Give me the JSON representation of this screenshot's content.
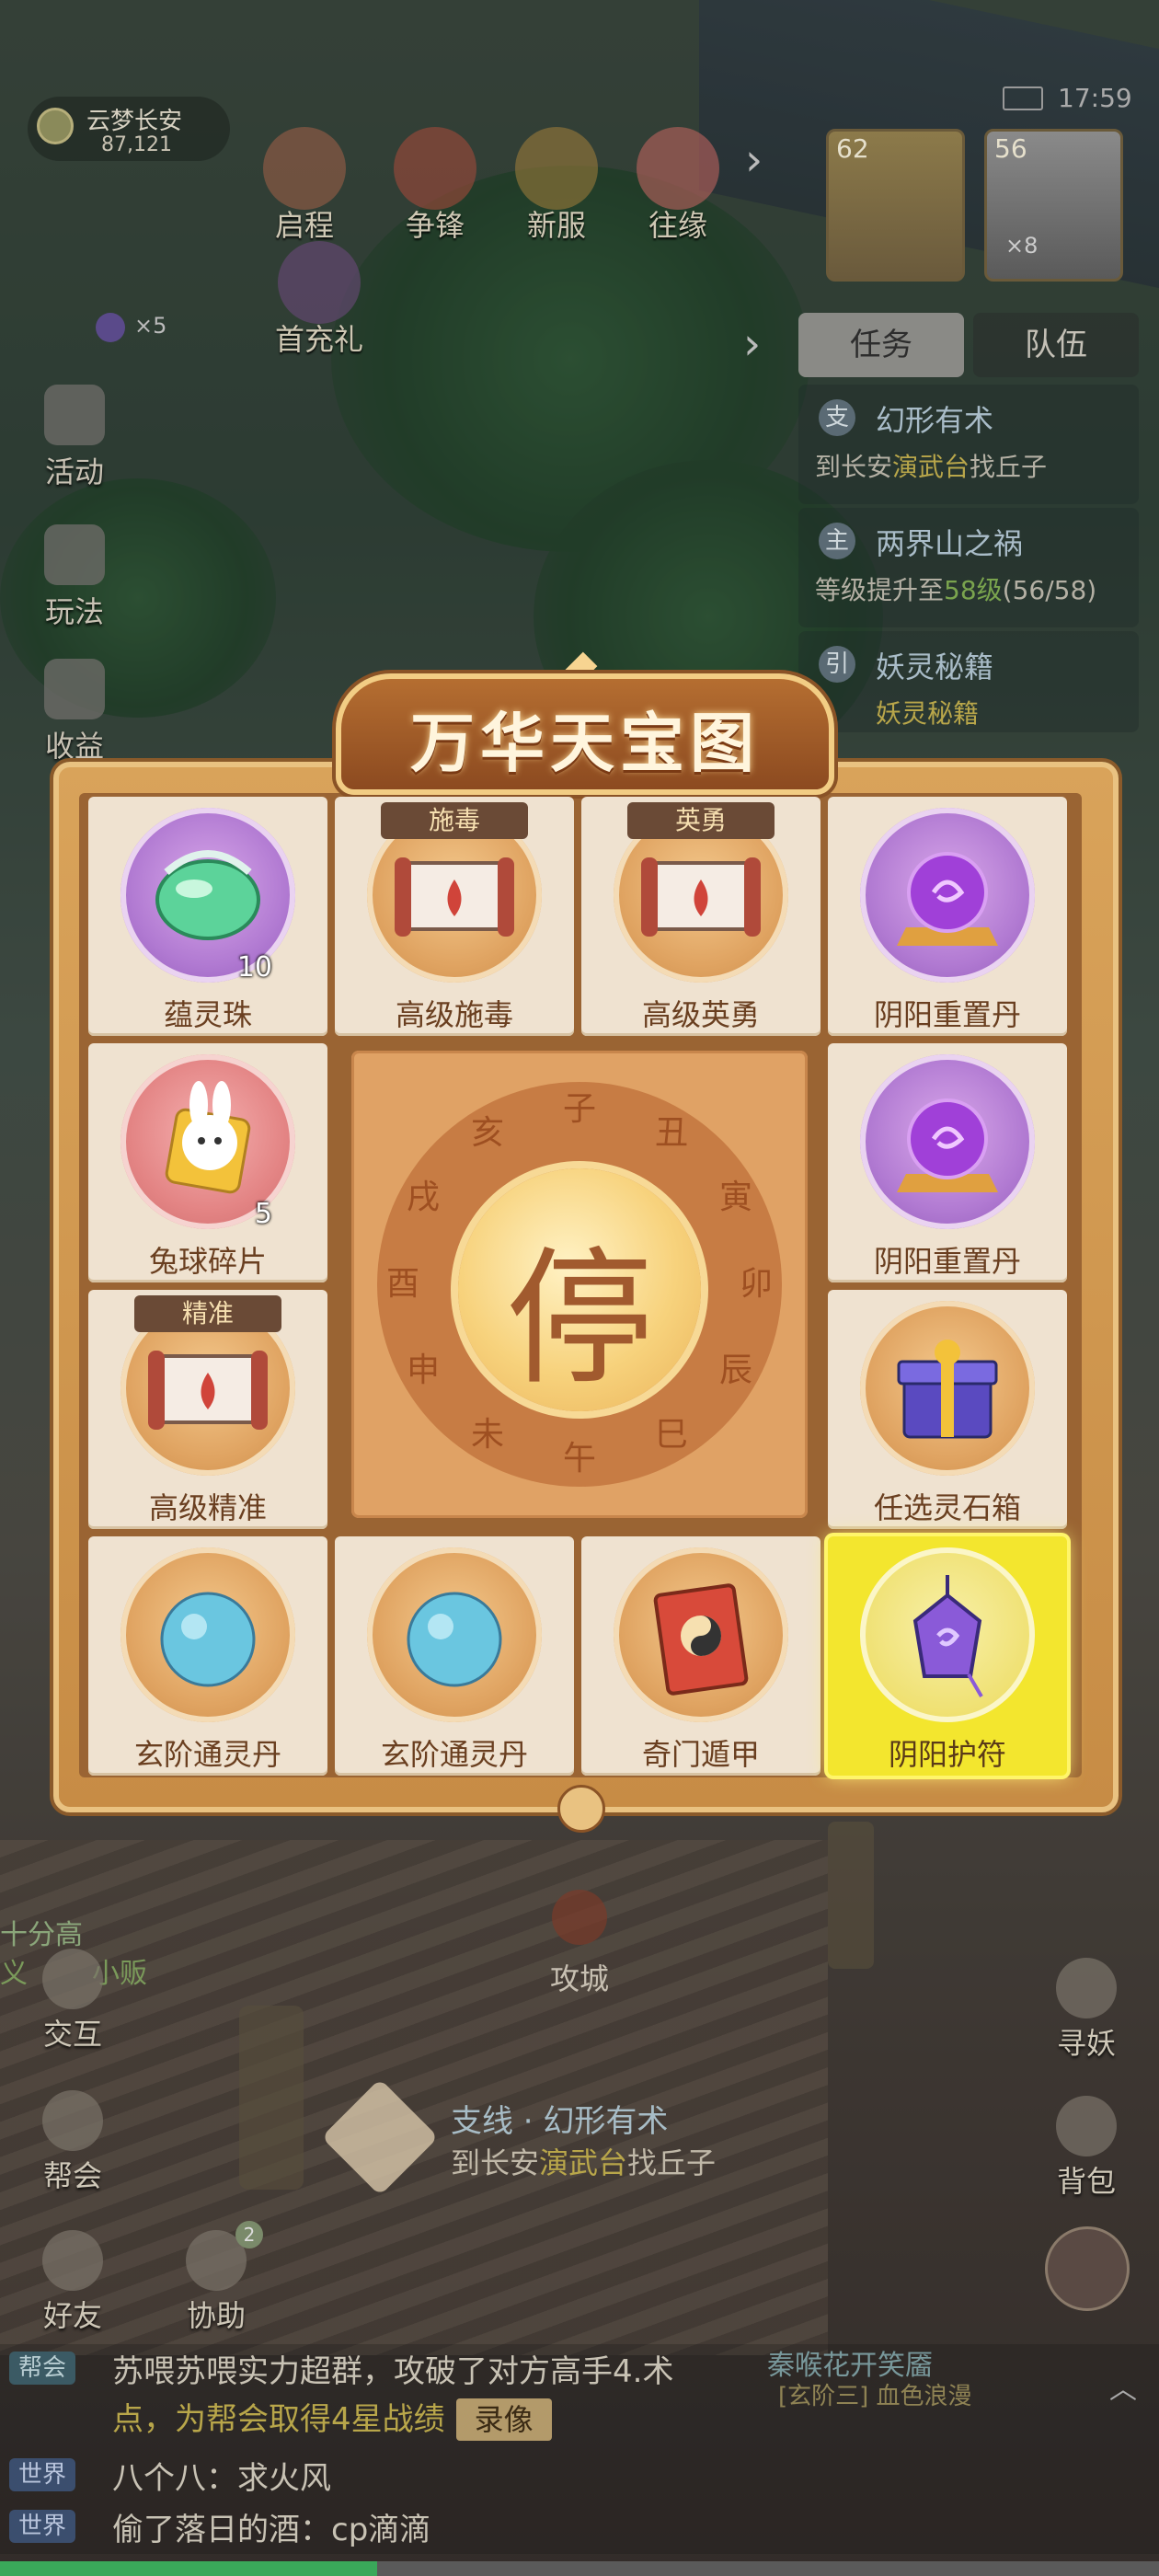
{
  "status": {
    "time": "17:59"
  },
  "location": {
    "name": "云梦长安",
    "coord": "87,121"
  },
  "top_icons": [
    {
      "label": "启程"
    },
    {
      "label": "争锋"
    },
    {
      "label": "新服"
    },
    {
      "label": "往缘"
    },
    {
      "label": "首充礼"
    }
  ],
  "currency": {
    "count": "×5"
  },
  "left_side": [
    {
      "label": "活动"
    },
    {
      "label": "玩法"
    },
    {
      "label": "收益"
    }
  ],
  "party": [
    {
      "level": "62"
    },
    {
      "level": "56",
      "count": "×8"
    }
  ],
  "tabs": [
    {
      "label": "任务"
    },
    {
      "label": "队伍"
    }
  ],
  "quests": [
    {
      "badge": "支",
      "title": "幻形有术",
      "desc_prefix": "到长安",
      "desc_highlight": "演武台",
      "desc_suffix": "找丘子"
    },
    {
      "badge": "主",
      "title": "两界山之祸",
      "desc_prefix": "等级提升至",
      "desc_highlight": "58级",
      "desc_suffix": "(56/58)"
    },
    {
      "badge": "引",
      "title": "妖灵秘籍",
      "desc_prefix": "",
      "desc_highlight": "",
      "desc_suffix": "妖灵秘籍"
    }
  ],
  "dialog": {
    "title": "万华天宝图",
    "stop_label": "停",
    "ring_chars": [
      "子",
      "丑",
      "寅",
      "卯",
      "辰",
      "巳",
      "午",
      "未",
      "申",
      "酉",
      "戌",
      "亥"
    ],
    "items": [
      {
        "name": "蕴灵珠",
        "qty": "10",
        "tag": "",
        "medal": "purple",
        "icon": "green-jade-orb-icon"
      },
      {
        "name": "高级施毒",
        "qty": "",
        "tag": "施毒",
        "medal": "orange",
        "icon": "scroll-icon"
      },
      {
        "name": "高级英勇",
        "qty": "",
        "tag": "英勇",
        "medal": "orange",
        "icon": "scroll-icon"
      },
      {
        "name": "阴阳重置丹",
        "qty": "",
        "tag": "",
        "medal": "purple",
        "icon": "purple-orb-icon"
      },
      {
        "name": "兔球碎片",
        "qty": "5",
        "tag": "",
        "medal": "pink",
        "icon": "rabbit-puzzle-icon"
      },
      {
        "name": "阴阳重置丹",
        "qty": "",
        "tag": "",
        "medal": "purple",
        "icon": "purple-orb-icon"
      },
      {
        "name": "高级精准",
        "qty": "",
        "tag": "精准",
        "medal": "orange",
        "icon": "scroll-icon"
      },
      {
        "name": "任选灵石箱",
        "qty": "",
        "tag": "",
        "medal": "orange",
        "icon": "gift-box-icon"
      },
      {
        "name": "玄阶通灵丹",
        "qty": "",
        "tag": "",
        "medal": "orange",
        "icon": "blue-pill-icon"
      },
      {
        "name": "玄阶通灵丹",
        "qty": "",
        "tag": "",
        "medal": "orange",
        "icon": "blue-pill-icon"
      },
      {
        "name": "奇门遁甲",
        "qty": "",
        "tag": "",
        "medal": "orange",
        "icon": "taiji-book-icon"
      },
      {
        "name": "阴阳护符",
        "qty": "",
        "tag": "",
        "medal": "orange",
        "icon": "purple-amulet-icon",
        "selected": true
      }
    ]
  },
  "bottom_left": [
    {
      "label": "交互"
    },
    {
      "label": "帮会"
    },
    {
      "label": "好友"
    },
    {
      "label": "协助"
    }
  ],
  "bottom_right": [
    {
      "label": "寻妖"
    },
    {
      "label": "背包"
    }
  ],
  "center_label": "攻城",
  "task_tracker": {
    "title": "支线 · 幻形有术",
    "desc_prefix": "到长安",
    "desc_highlight": "演武台",
    "desc_suffix": "找丘子"
  },
  "side_text": {
    "left1": "十分高",
    "left2": "义",
    "left3": "小贩"
  },
  "help_badge": "2",
  "npc_label": "秦喉花开笑靥",
  "npc_sub": "[玄阶三] 血色浪漫",
  "chat": [
    {
      "channel": "帮会",
      "line1": "苏喂苏喂实力超群，攻破了对方高手4.术",
      "line2": "点，为帮会取得4星战绩",
      "replay": "录像"
    },
    {
      "channel": "世界",
      "text": "八个八：求火风"
    },
    {
      "channel": "世界",
      "text": "偷了落日的酒：cp滴滴"
    }
  ],
  "colors": {
    "selected": "#f3e62e",
    "panel": "#d9a35a",
    "title_text": "#fff5dd"
  }
}
